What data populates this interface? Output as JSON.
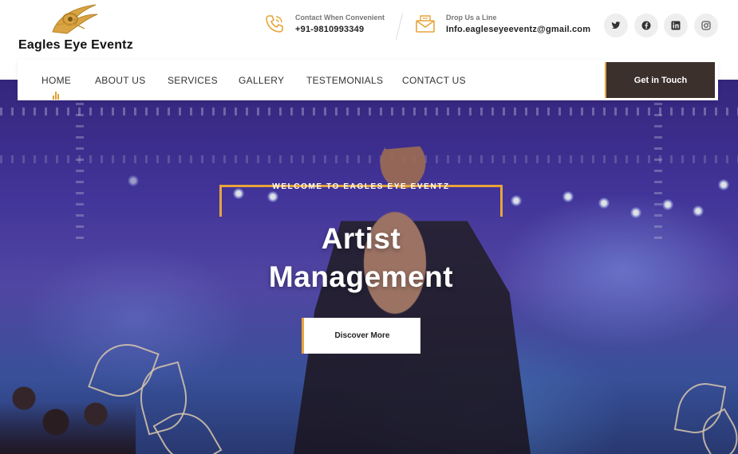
{
  "brand": {
    "name": "Eagles Eye Eventz",
    "logo_icon": "eagle-eye-logo",
    "accent": "#e8a43b"
  },
  "contact": {
    "phone": {
      "label": "Contact When Convenient",
      "value": "+91-9810993349",
      "icon": "phone-icon"
    },
    "email": {
      "label": "Drop Us a Line",
      "value": "Info.eagleseyeeventz@gmail.com",
      "icon": "mail-icon"
    }
  },
  "social": [
    {
      "name": "twitter",
      "icon": "twitter-icon",
      "glyph": "𝕏"
    },
    {
      "name": "facebook",
      "icon": "facebook-icon",
      "glyph": "f"
    },
    {
      "name": "linkedin",
      "icon": "linkedin-icon",
      "glyph": "in"
    },
    {
      "name": "instagram",
      "icon": "instagram-icon",
      "glyph": "◎"
    }
  ],
  "nav": {
    "items": [
      {
        "label": "HOME",
        "active": true
      },
      {
        "label": "ABOUT US"
      },
      {
        "label": "SERVICES"
      },
      {
        "label": "GALLERY"
      },
      {
        "label": "TESTEMONIALS"
      },
      {
        "label": "CONTACT US"
      }
    ],
    "cta_label": "Get in Touch",
    "cta_color": "#3b302c"
  },
  "hero": {
    "eyebrow": "WELCOME TO EAGLES EYE EVENTZ",
    "headline_line1": "Artist",
    "headline_line2": "Management",
    "button_label": "Discover More"
  }
}
